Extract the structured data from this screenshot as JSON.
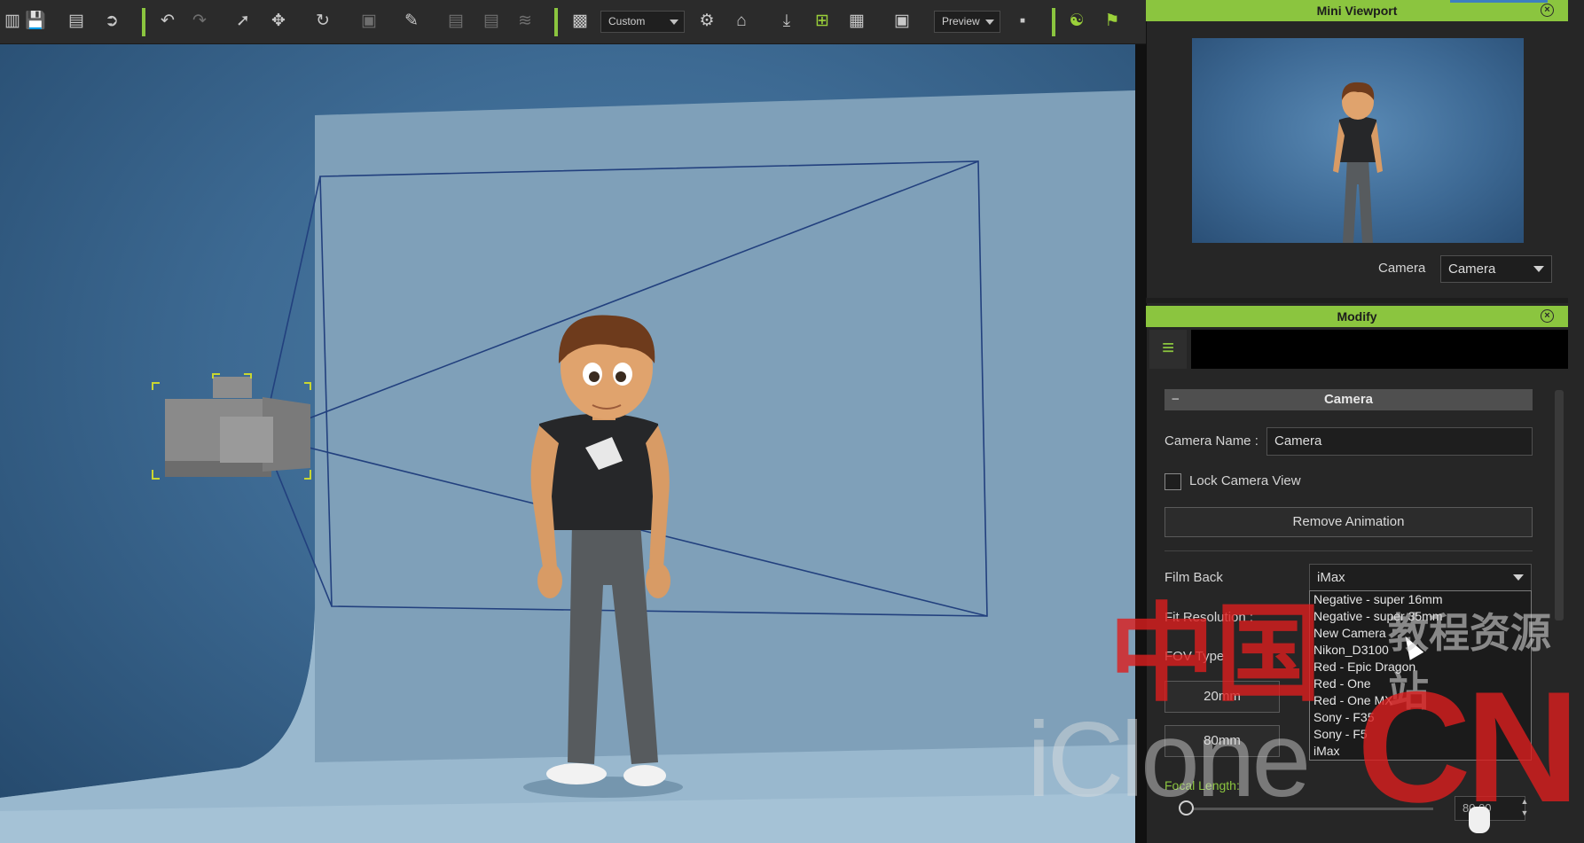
{
  "toolbar": {
    "view_mode_dropdown": "Custom",
    "render_mode_dropdown": "Preview",
    "icons": [
      "save-icon",
      "export-icon",
      "import-icon",
      "undo-icon",
      "redo-icon",
      "select-icon",
      "move-icon",
      "rotate-icon",
      "scale-icon",
      "paint-icon",
      "align-left-icon",
      "align-center-icon",
      "blink-icon",
      "window-icon",
      "light-icon",
      "home-icon",
      "download-icon",
      "add-icon",
      "snap-icon",
      "zoom-extents-icon",
      "video-camera-icon",
      "pose-icon",
      "flag-icon"
    ],
    "colors": {
      "accent": "#8bc53f",
      "bar": "#2b2b2b"
    }
  },
  "mini_viewport": {
    "title": "Mini Viewport",
    "camera_label": "Camera",
    "camera_value": "Camera"
  },
  "modify": {
    "title": "Modify",
    "section_title": "Camera",
    "camera_name_label": "Camera Name :",
    "camera_name_value": "Camera",
    "lock_view_label": "Lock Camera View",
    "lock_view_checked": false,
    "remove_animation_label": "Remove Animation",
    "film_back_label": "Film Back",
    "film_back_value": "iMax",
    "fit_resolution_label": "Fit Resolution :",
    "fov_type_label": "FOV Type",
    "lens_presets": [
      "20mm",
      "80mm"
    ],
    "focal_length_label": "Focal Length:",
    "focal_length_value": "80.00",
    "film_back_options": [
      "Negative - super 16mm",
      "Negative - super 35mm",
      "New Camera",
      "Nikon_D3100",
      "Red - Epic Dragon",
      "Red - One",
      "Red - One MX",
      "Sony - F35",
      "Sony - F5",
      "iMax"
    ]
  },
  "watermark": {
    "cn_text": "中国",
    "site_text": "教程资源站",
    "brand_text": "iClone",
    "cn_suffix": "CN"
  }
}
